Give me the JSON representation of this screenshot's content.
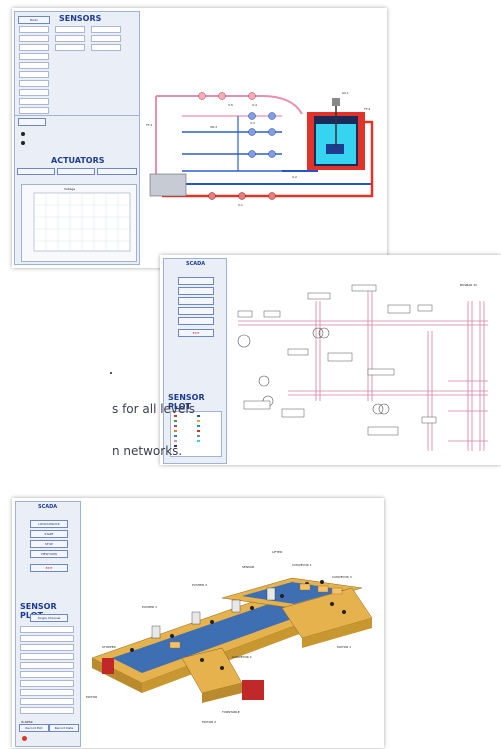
{
  "body_text": {
    "line1": "s for all levels",
    "line2": "n networks."
  },
  "shot1": {
    "sensors_title": "SENSORS",
    "actuators_title": "ACTUATORS",
    "legend": "Voltage",
    "node_labels": [
      "FT-1",
      "V-5",
      "V-4",
      "V-3",
      "AV-1",
      "TT-1",
      "VR-3",
      "VS-1",
      "V-2",
      "V-1",
      "LT-1",
      "TT-2",
      "TT-3"
    ]
  },
  "shot2": {
    "panel_title": "SCADA",
    "sensor_plot": "SENSOR PLOT",
    "button_red": "EXIT",
    "right_label": "BUSBAR 3C"
  },
  "shot3": {
    "panel_title": "SCADA",
    "buttons": [
      "LOCK/UNLOCK",
      "START",
      "STOP",
      "VIEW DATA",
      "EXIT"
    ],
    "sensor_plot": "SENSOR PLOT",
    "plot_subtitle": "Single Channel",
    "sensor_rows": [
      "SPW-01",
      "IS-RPS1",
      "IS-RPS2",
      "IS-RPS3",
      "IS-RPS4",
      "IS-RPS5",
      "IS-RPS6",
      "IS-RPS7",
      "IS-RPS8",
      "IS-RPS9"
    ],
    "bottom_buttons": [
      "Record Plot",
      "Record Data"
    ],
    "conveyor_labels": [
      "CONVEYOR 1",
      "CONVEYOR 2",
      "CONVEYOR 3",
      "PUSHER 1",
      "PUSHER 2",
      "SENSOR",
      "MOTOR 1",
      "MOTOR 2",
      "TURNTABLE",
      "STOPPER",
      "LIFTER",
      "MOTOR"
    ]
  },
  "colors": {
    "panel": "#e9eef7",
    "title": "#1d3b8f",
    "pipe_red": "#e2332a",
    "pipe_blue": "#2454c9",
    "pipe_pink": "#e88fb0",
    "tank_cyan": "#36d4f0",
    "conveyor_gold": "#d9a63c",
    "belt_blue": "#3f6fb3"
  }
}
